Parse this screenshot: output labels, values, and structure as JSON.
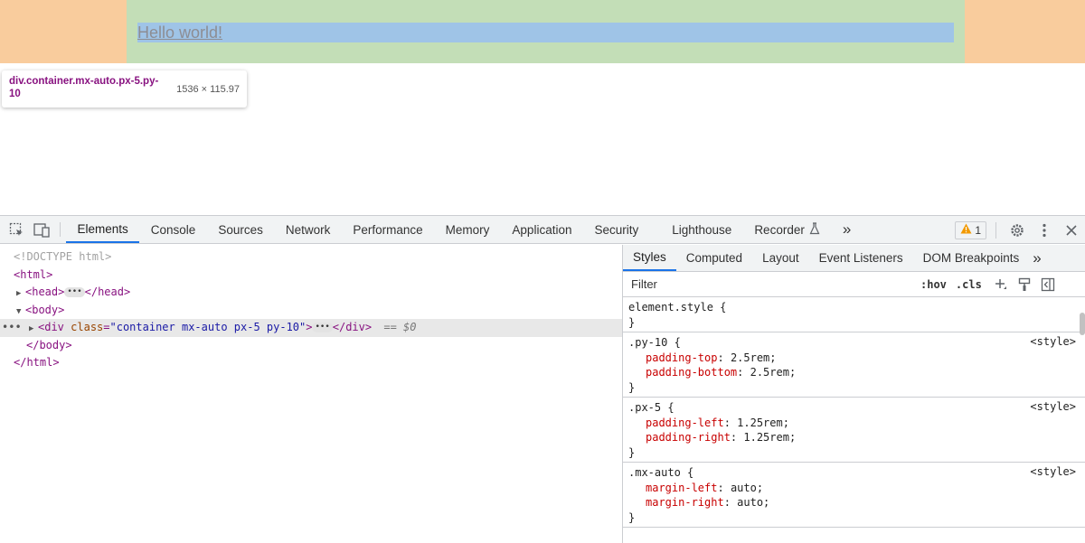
{
  "viewport": {
    "hello_text": "Hello world!",
    "tooltip": {
      "selector": "div.container.mx-auto.px-5.py-10",
      "size": "1536 × 115.97"
    }
  },
  "devtools": {
    "tabs": [
      "Elements",
      "Console",
      "Sources",
      "Network",
      "Performance",
      "Memory",
      "Application",
      "Security",
      "Lighthouse",
      "Recorder"
    ],
    "active_tab": "Elements",
    "more_tabs": "»",
    "warning_count": "1",
    "dom": {
      "doctype": "<!DOCTYPE html>",
      "html_open": "<html>",
      "head_open": "<head>",
      "head_close": "</head>",
      "body_open": "<body>",
      "div_open": "<div",
      "div_attr": "class",
      "div_class": "\"container mx-auto px-5 py-10\"",
      "div_close": "</div>",
      "selected_marker": "== $0",
      "body_close": "</body>",
      "html_close": "</html>"
    },
    "styles": {
      "tabs": [
        "Styles",
        "Computed",
        "Layout",
        "Event Listeners",
        "DOM Breakpoints"
      ],
      "active_tab": "Styles",
      "more": "»",
      "filter_placeholder": "Filter",
      "hov": ":hov",
      "cls": ".cls",
      "rules": [
        {
          "selector": "element.style {",
          "origin": "",
          "props": []
        },
        {
          "selector": ".py-10 {",
          "origin": "<style>",
          "props": [
            {
              "name": "padding-top",
              "value": "2.5rem;"
            },
            {
              "name": "padding-bottom",
              "value": "2.5rem;"
            }
          ]
        },
        {
          "selector": ".px-5 {",
          "origin": "<style>",
          "props": [
            {
              "name": "padding-left",
              "value": "1.25rem;"
            },
            {
              "name": "padding-right",
              "value": "1.25rem;"
            }
          ]
        },
        {
          "selector": ".mx-auto {",
          "origin": "<style>",
          "props": [
            {
              "name": "margin-left",
              "value": "auto;"
            },
            {
              "name": "margin-right",
              "value": "auto;"
            }
          ]
        }
      ],
      "close_brace": "}"
    },
    "colors": {
      "margin_overlay": "#f9cc9d",
      "padding_overlay": "#c3deb7",
      "content_overlay": "#9fc4e7",
      "accent": "#1a73e8",
      "warning": "#f29900"
    }
  }
}
